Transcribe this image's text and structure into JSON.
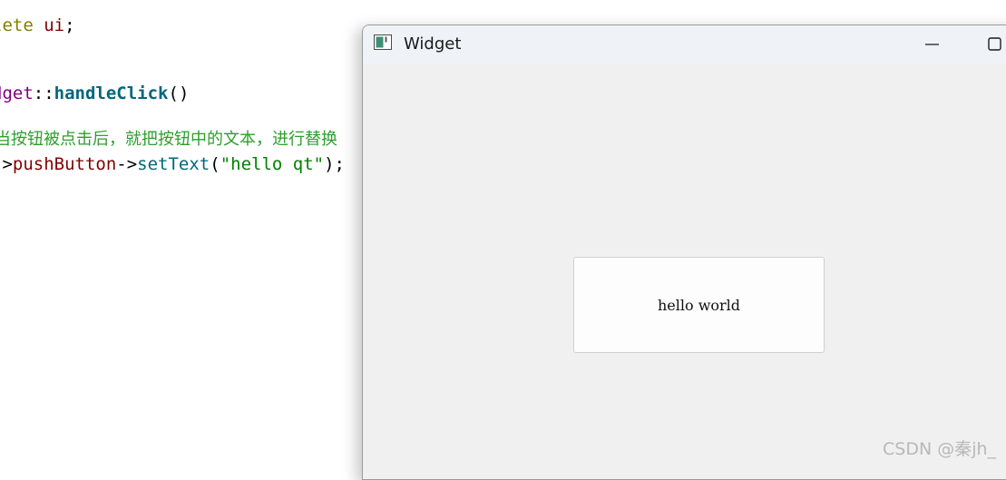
{
  "editor": {
    "line1": {
      "keyword": "lete",
      "ident": "ui",
      "end": ";"
    },
    "line2": {
      "cls": "dget",
      "sep": "::",
      "fn": "handleClick",
      "parens": "()"
    },
    "line3": {
      "comment": "当按钮被点击后，就把按钮中的文本，进行替换"
    },
    "line4": {
      "arrow1": "->",
      "member": "pushButton",
      "arrow2": "->",
      "call": "setText",
      "open": "(",
      "str": "\"hello qt\"",
      "close": ");"
    }
  },
  "window": {
    "title": "Widget",
    "icon": "qt-widget-app-icon",
    "controls": [
      "minimize-icon",
      "maximize-icon"
    ]
  },
  "push_button": {
    "label": "hello world"
  },
  "watermark": {
    "text": "CSDN @秦jh_"
  }
}
